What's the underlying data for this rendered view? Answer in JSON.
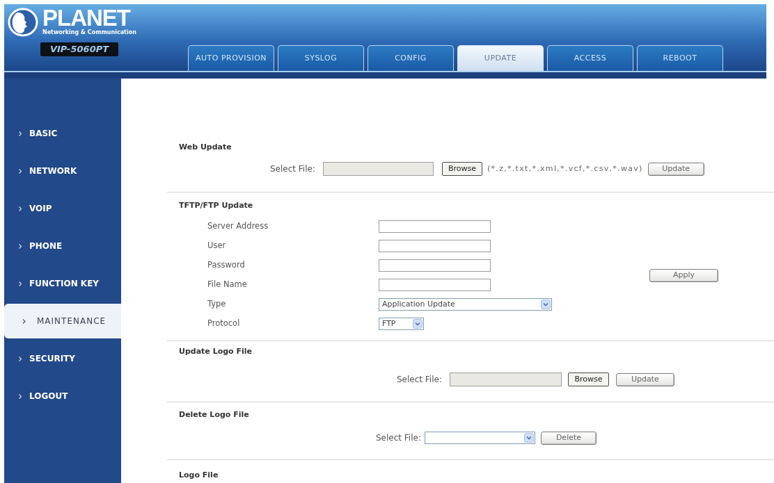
{
  "header": {
    "logo": {
      "name": "PLANET",
      "tagline": "Networking & Communication"
    },
    "model": "VIP-5060PT"
  },
  "tabs": [
    {
      "label": "AUTO PROVISION",
      "selected": false
    },
    {
      "label": "SYSLOG",
      "selected": false
    },
    {
      "label": "CONFIG",
      "selected": false
    },
    {
      "label": "UPDATE",
      "selected": true
    },
    {
      "label": "ACCESS",
      "selected": false
    },
    {
      "label": "REBOOT",
      "selected": false
    }
  ],
  "sidebar": {
    "items": [
      {
        "label": "BASIC",
        "selected": false
      },
      {
        "label": "NETWORK",
        "selected": false
      },
      {
        "label": "VOIP",
        "selected": false
      },
      {
        "label": "PHONE",
        "selected": false
      },
      {
        "label": "FUNCTION KEY",
        "selected": false
      },
      {
        "label": "MAINTENANCE",
        "selected": true
      },
      {
        "label": "SECURITY",
        "selected": false
      },
      {
        "label": "LOGOUT",
        "selected": false
      }
    ]
  },
  "sections": [
    {
      "kind": "upload",
      "title": "Web Update",
      "file_label": "Select File:",
      "browse": "Browse",
      "hint": "(*.z,*.txt,*.xml,*.vcf,*.csv,*.wav)",
      "button": "Update"
    },
    {
      "kind": "form",
      "title": "TFTP/FTP Update",
      "fields": [
        {
          "kind": "text",
          "label": "Server Address"
        },
        {
          "kind": "text",
          "label": "User"
        },
        {
          "kind": "password",
          "label": "Password"
        },
        {
          "kind": "text",
          "label": "File Name"
        },
        {
          "kind": "select",
          "label": "Type",
          "value": "Application Update"
        },
        {
          "kind": "smallselect",
          "label": "Protocol",
          "value": "FTP"
        }
      ],
      "button": "Apply"
    },
    {
      "kind": "upload",
      "title": "Update Logo File",
      "file_label": "Select File:",
      "browse": "Browse",
      "button": "Update"
    },
    {
      "kind": "delete",
      "title": "Delete Logo File",
      "file_label": "Select File:",
      "button": "Delete"
    },
    {
      "kind": "heading",
      "title": "Logo File"
    }
  ]
}
